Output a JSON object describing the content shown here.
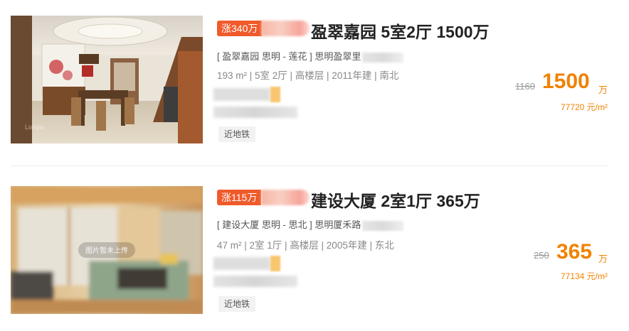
{
  "listings": [
    {
      "rise_tag": "涨340万",
      "title": "盈翠嘉园 5室2厅 1500万",
      "community": {
        "name": "盈翠嘉园",
        "district": "思明",
        "area": "莲花",
        "address": "思明盈翠里"
      },
      "info": "193 m² | 5室 2厅 | 高楼层 | 2011年建 | 南北",
      "feature_tag": "近地铁",
      "old_price": "1160",
      "price": "1500",
      "price_unit": "万",
      "unit_price": "77720 元/m²",
      "photo_watermark": "Ke.lianjia.com"
    },
    {
      "rise_tag": "涨115万",
      "title": "建设大厦 2室1厅 365万",
      "community": {
        "name": "建设大厦",
        "district": "思明",
        "area": "思北",
        "address": "思明厦禾路"
      },
      "info": "47 m² | 2室 1厅 | 高楼层 | 2005年建 | 东北",
      "feature_tag": "近地铁",
      "old_price": "250",
      "price": "365",
      "price_unit": "万",
      "unit_price": "77134 元/m²",
      "photo_caption": "图片暂未上传"
    }
  ],
  "colors": {
    "accent": "#f08200",
    "rise_tag": "#f05a2b"
  }
}
